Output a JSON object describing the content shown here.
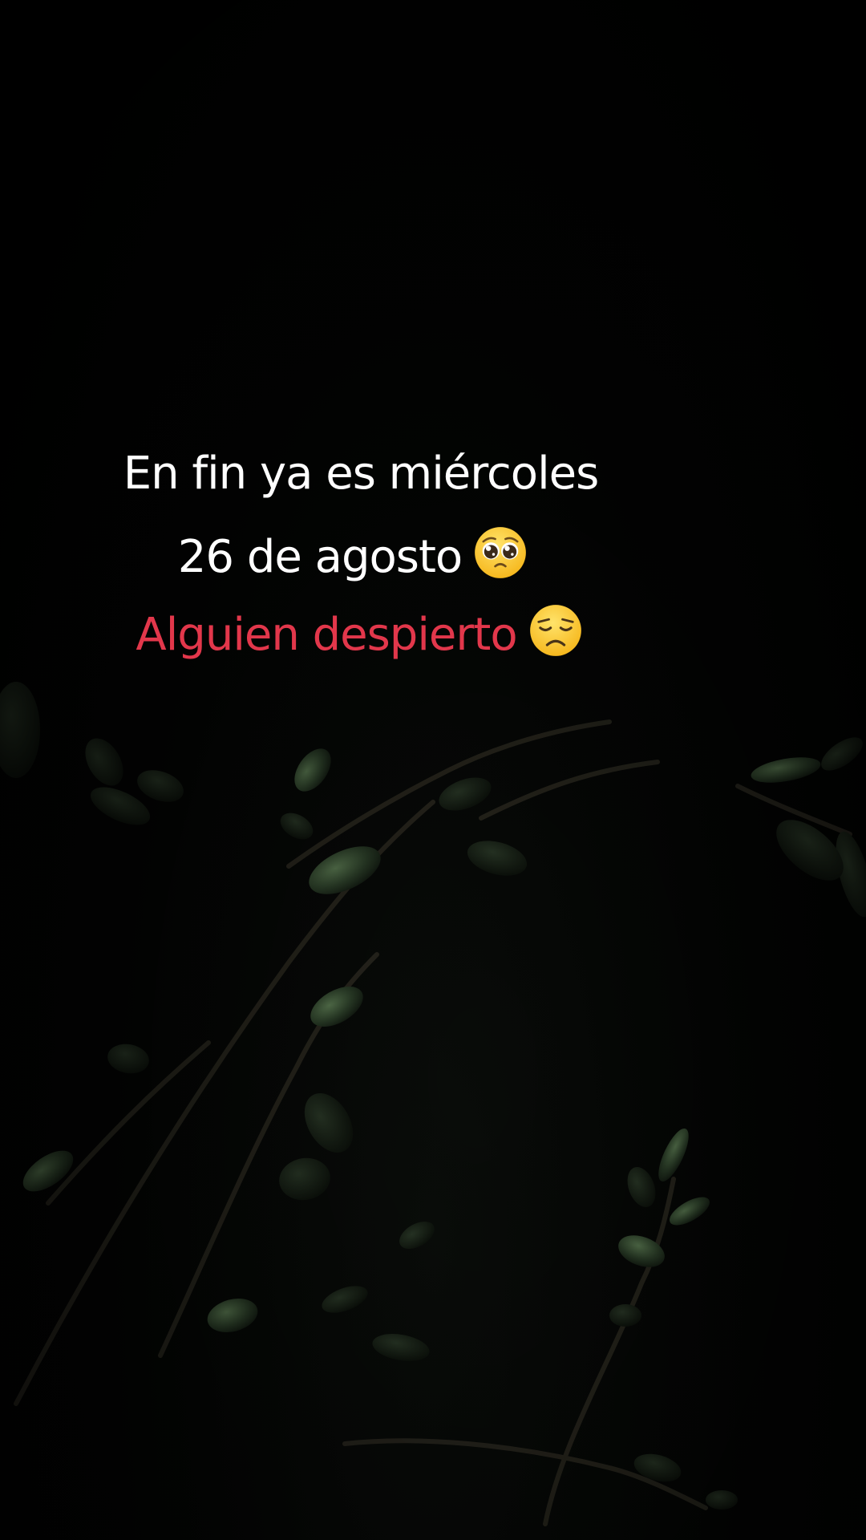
{
  "caption": {
    "line1": "En fin ya es miércoles",
    "line2": "26 de agosto",
    "line3": "Alguien despierto"
  },
  "emojis": {
    "line2": "pleading-face-emoji",
    "line3": "disappointed-face-emoji"
  },
  "colors": {
    "background": "#000000",
    "text_primary": "#ffffff",
    "text_accent": "#e2374b",
    "foliage": "#3f5a3a"
  }
}
